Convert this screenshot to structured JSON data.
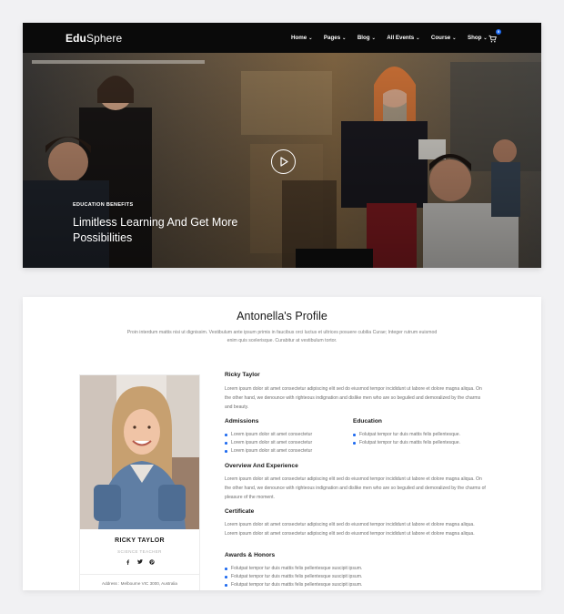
{
  "brand": {
    "name_bold": "Edu",
    "name_light": "Sphere"
  },
  "nav": {
    "items": [
      {
        "label": "Home"
      },
      {
        "label": "Pages"
      },
      {
        "label": "Blog"
      },
      {
        "label": "All Events"
      },
      {
        "label": "Course"
      },
      {
        "label": "Shop"
      }
    ],
    "caret": "⌄",
    "cart_count": "0"
  },
  "hero": {
    "eyebrow": "EDUCATION BENEFITS",
    "title": "Limitless Learning And Get More Possibilities"
  },
  "profile": {
    "title": "Antonella's Profile",
    "intro": "Proin interdum mattis nisi ut dignissim. Vestibulum ante ipsum primis in faucibus orci luctus et ultrices posuere cubilia Curae; Integer rutrum euismod enim quis scelerisque. Curabitur at vestibulum tortor.",
    "card": {
      "name": "RICKY TAYLOR",
      "role": "SCIENCE TEACHER",
      "address": "Address : Melbourne VIC 3000, Australia"
    },
    "sections": {
      "about_heading": "Ricky Taylor",
      "about_text": "Lorem ipsum dolor sit amet consectetur adipiscing elit sed do eiusmod tempor incididunt ut labore et dolore magna aliqua. On the other hand, we denounce with righteous indignation and dislike men who are so beguiled and demoralized by the charms and beauty.",
      "admissions_heading": "Admissions",
      "admissions_items": [
        "Lorem ipsum dolor sit amet consectetur",
        "Lorem ipsum dolor sit amet consectetur",
        "Lorem ipsum dolor sit amet consectetur"
      ],
      "education_heading": "Education",
      "education_items": [
        "Folutpat tempor tur duis mattis felis pellentesque.",
        "Folutpat tempor tur duis mattis felis pellentesque."
      ],
      "overview_heading": "Overview And Experience",
      "overview_text": "Lorem ipsum dolor sit amet consectetur adipiscing elit sed do eiusmod tempor incididunt ut labore et dolore magna aliqua. On the other hand, we denounce with righteous indignation and dislike men who are so beguiled and demoralized by the charms of pleasure of the moment.",
      "certificate_heading": "Certificate",
      "certificate_text": "Lorem ipsum dolor sit amet consectetur adipiscing elit sed do eiusmod tempor incididunt ut labore et dolore magna aliqua. Lorem ipsum dolor sit amet consectetur adipiscing elit sed do eiusmod tempor incididunt ut labore et dolore magna aliqua.",
      "awards_heading": "Awards & Honors",
      "awards_items": [
        "Folutpat tempor tur duis mattis felis pellentesque suscipit ipsum.",
        "Folutpat tempor tur duis mattis felis pellentesque suscipit ipsum.",
        "Folutpat tempor tur duis mattis felis pellentesque suscipit ipsum."
      ]
    }
  },
  "icons": {
    "play": "play-icon",
    "cart": "cart-icon",
    "social": [
      "facebook-icon",
      "twitter-icon",
      "pinterest-icon"
    ]
  },
  "colors": {
    "accent": "#1f6bf0",
    "nav_bg": "#0a0a0a",
    "page_bg": "#f1f1f3"
  }
}
